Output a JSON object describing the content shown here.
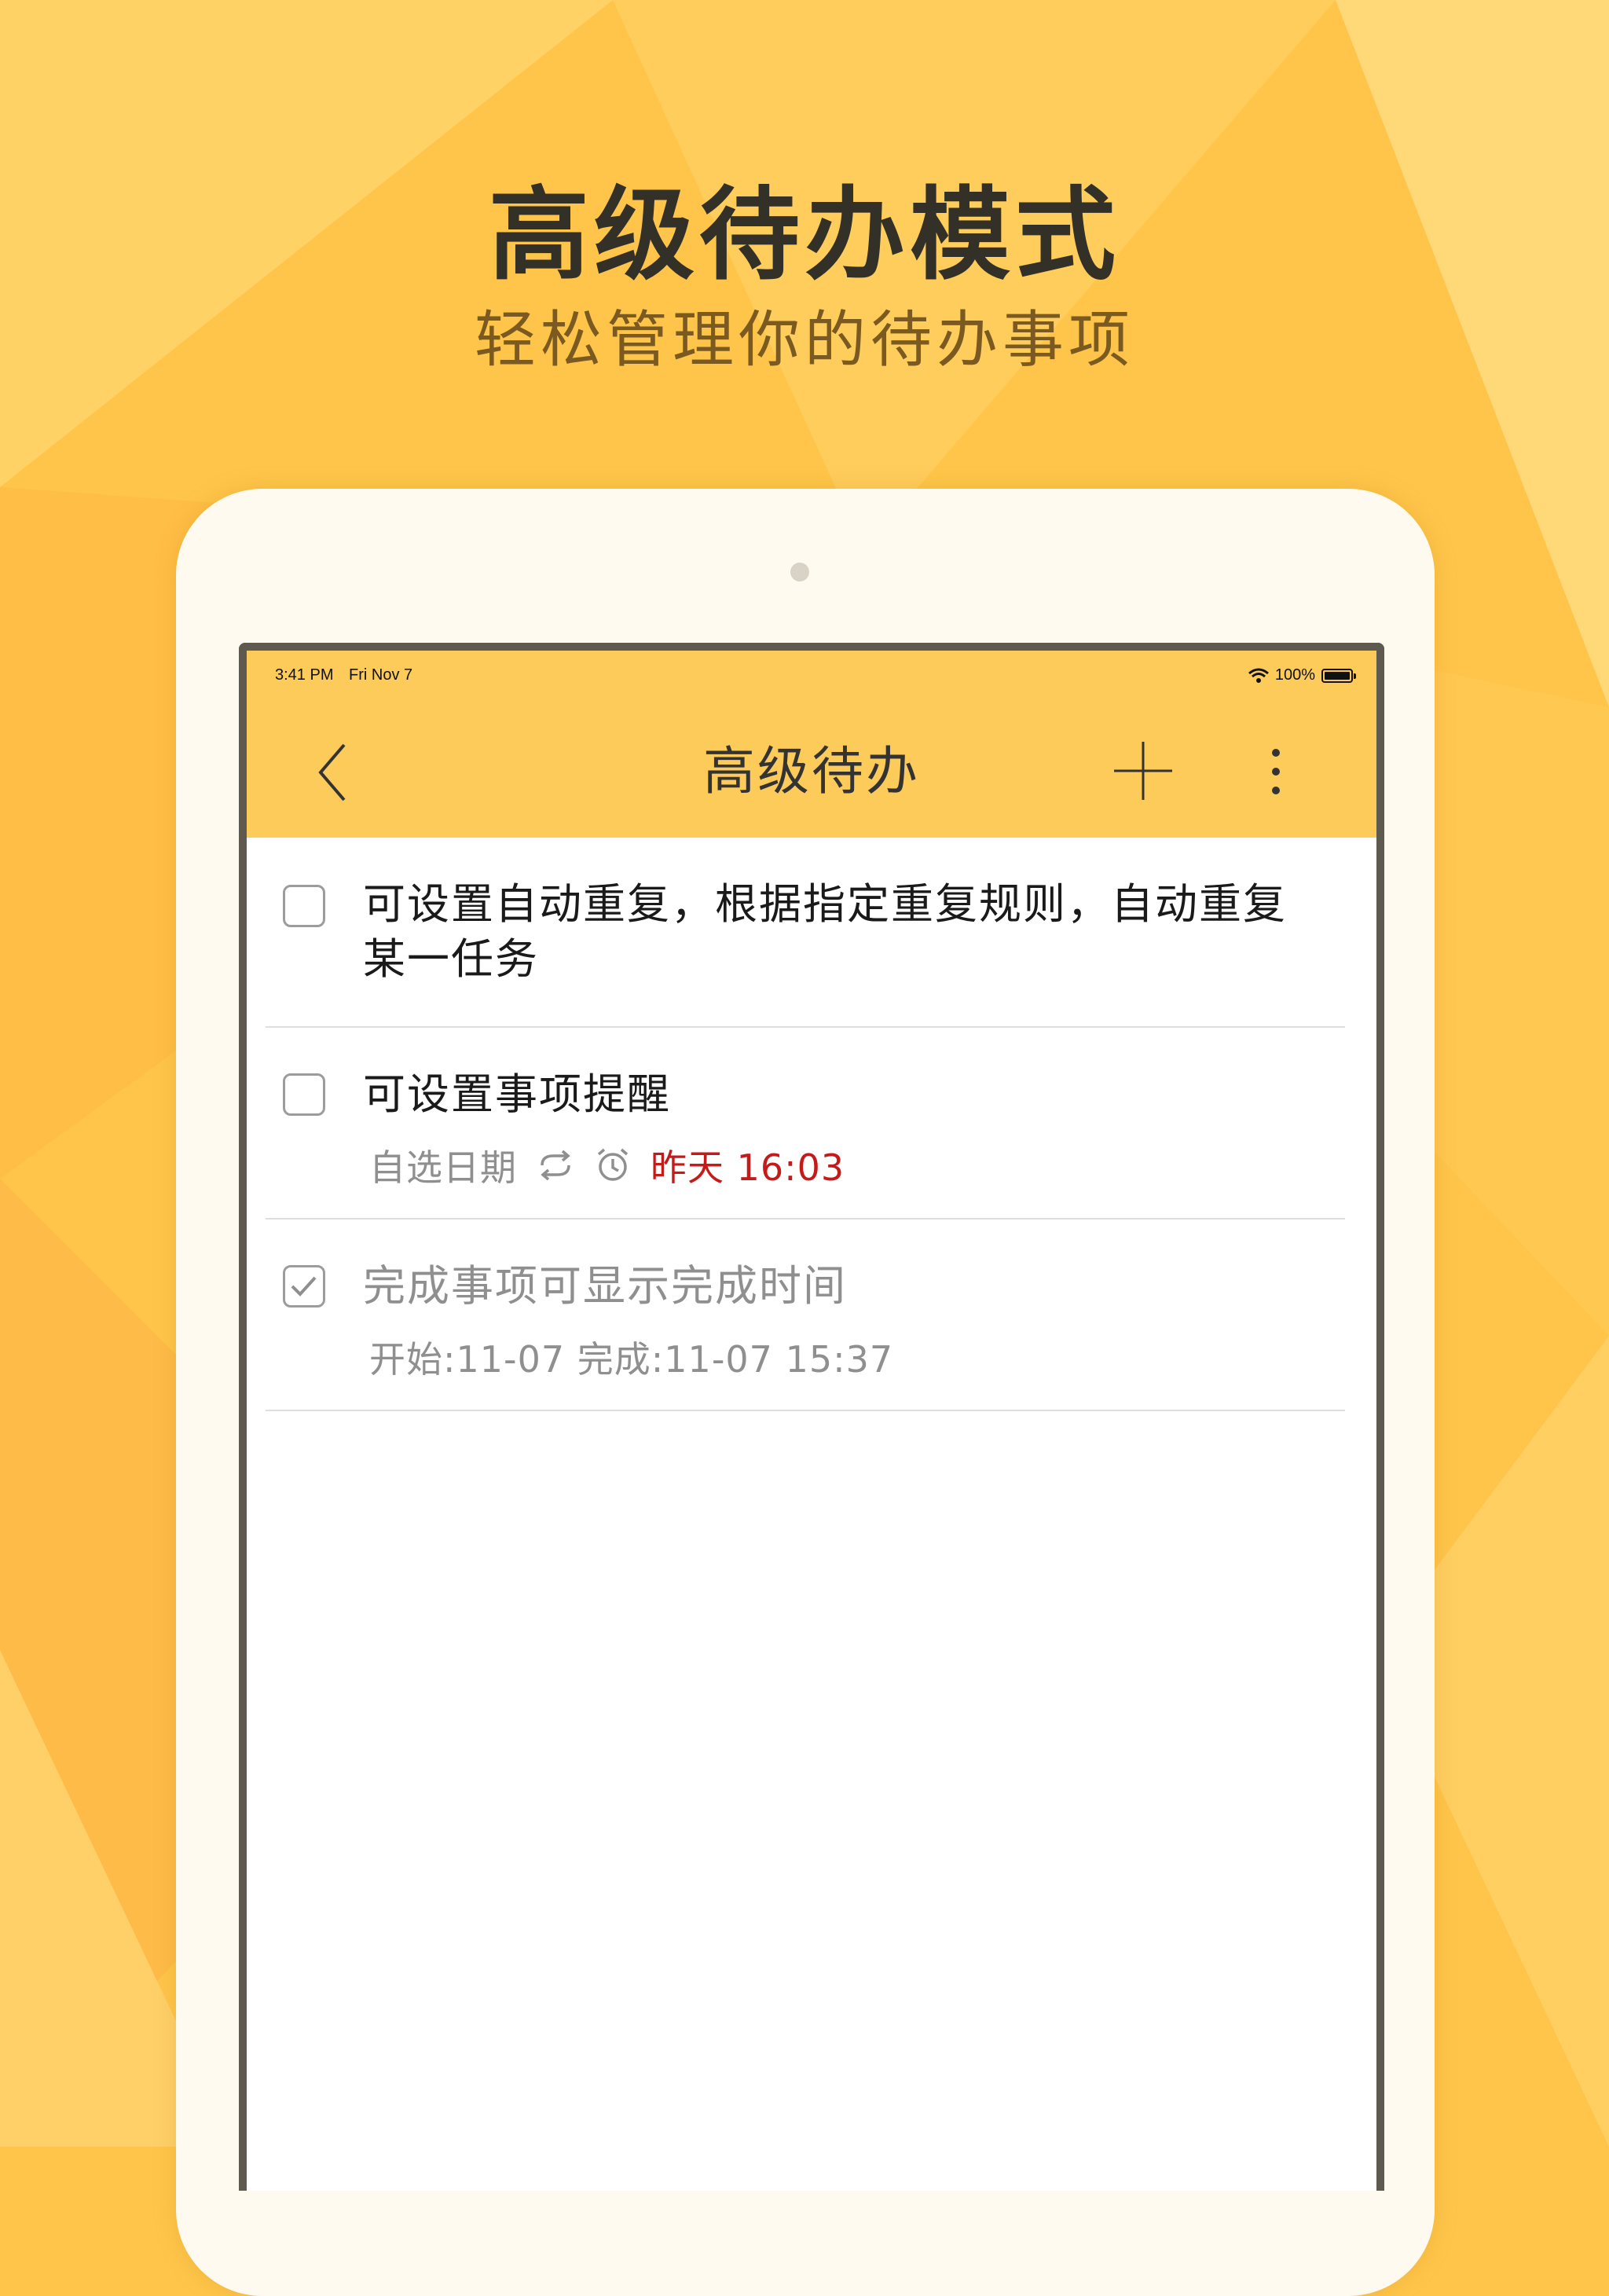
{
  "promo": {
    "title": "高级待办模式",
    "subtitle": "轻松管理你的待办事项"
  },
  "status_bar": {
    "time": "3:41 PM",
    "date": "Fri Nov 7",
    "battery": "100%"
  },
  "app_bar": {
    "title": "高级待办"
  },
  "todos": [
    {
      "text": "可设置自动重复，根据指定重复规则，自动重复某一任务",
      "checked": false
    },
    {
      "text": "可设置事项提醒",
      "checked": false,
      "meta": {
        "date_label": "自选日期",
        "reminder": "昨天 16:03"
      }
    },
    {
      "text": "完成事项可显示完成时间",
      "checked": true,
      "meta": {
        "times": "开始:11-07 完成:11-07 15:37"
      }
    }
  ],
  "colors": {
    "background": "#ffc54a",
    "app_bar": "#fdcb5a",
    "reminder_overdue": "#c41a1a"
  },
  "icons": [
    "chevron-left-icon",
    "plus-icon",
    "more-vertical-icon",
    "repeat-icon",
    "alarm-icon",
    "check-icon",
    "wifi-icon",
    "battery-icon"
  ]
}
